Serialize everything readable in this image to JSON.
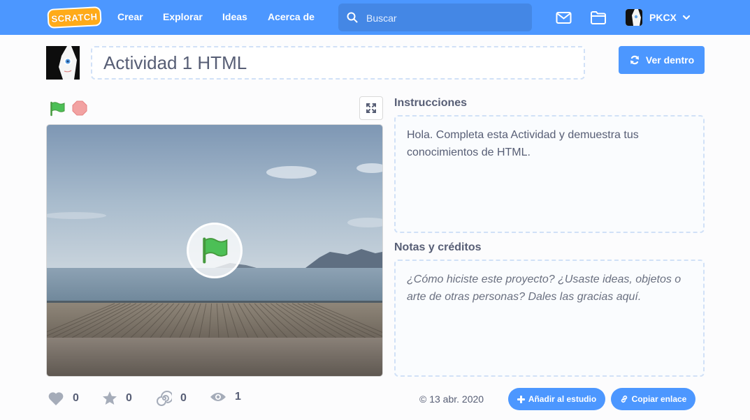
{
  "nav": {
    "logo_text": "SCRATCH",
    "links": [
      "Crear",
      "Explorar",
      "Ideas",
      "Acerca de"
    ],
    "search_placeholder": "Buscar",
    "username": "PKCX",
    "icons": [
      "search-icon",
      "messages-icon",
      "my-stuff-icon",
      "chevron-down-icon"
    ]
  },
  "project": {
    "title": "Actividad 1 HTML",
    "see_inside_label": "Ver dentro"
  },
  "instructions": {
    "label": "Instrucciones",
    "text": "Hola. Completa esta Actividad y demuestra tus conocimientos de HTML."
  },
  "notes": {
    "label": "Notas y créditos",
    "placeholder": "¿Cómo hiciste este proyecto? ¿Usaste ideas, objetos o arte de otras personas? Dales las gracias aquí."
  },
  "stats": {
    "loves": "0",
    "favorites": "0",
    "remixes": "0",
    "views": "1"
  },
  "footer": {
    "date": "© 13 abr. 2020",
    "add_to_studio_label": "Añadir al estudio",
    "copy_link_label": "Copiar enlace"
  },
  "colors": {
    "accent": "#4c97ff",
    "text": "#575e75",
    "flag_green": "#4cbf56",
    "stop_red": "#ec5959"
  }
}
